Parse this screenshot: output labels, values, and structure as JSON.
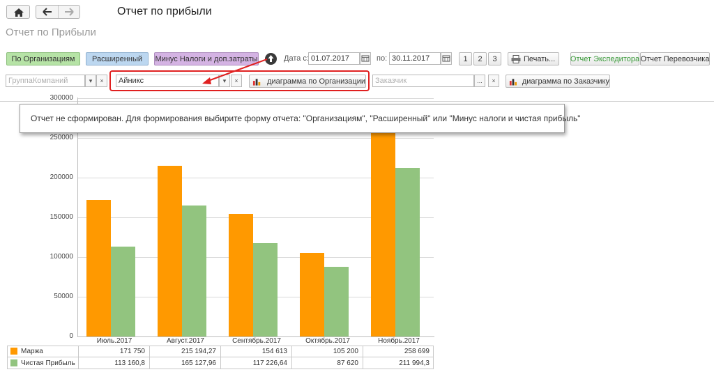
{
  "window": {
    "title": "Отчет по прибыли",
    "form_title": "Отчет по Прибыли"
  },
  "toolbar": {
    "by_org_label": "По Организациям",
    "extended_label": "Расширенный",
    "minus_taxes_label": "Минус Налоги и доп.затраты",
    "date_from_label": "Дата с:",
    "date_from": "01.07.2017",
    "date_to_label": "по:",
    "date_to": "30.11.2017",
    "pages": [
      "1",
      "2",
      "3"
    ],
    "print_label": "Печать...",
    "report_forwarder_label": "Отчет Экспедитора",
    "report_carrier_label": "Отчет Перевозчика"
  },
  "filters": {
    "group_placeholder": "ГруппаКомпаний",
    "org_value": "Айникс",
    "org_chart_label": "диаграмма по Организации",
    "customer_placeholder": "Заказчик",
    "customer_chart_label": "диаграмма по Заказчику"
  },
  "message": "Отчет не сформирован. Для формирования выбирите форму отчета: \"Организациям\", \"Расширенный\" или \"Минус налоги и чистая прибыль\"",
  "colors": {
    "margin": "#ff9900",
    "net_profit": "#92c47f",
    "highlight": "#e02020",
    "by_org_bg": "#b6e3a6",
    "extended_bg": "#bcd7f0",
    "minus_taxes_bg": "#d4b3e3"
  },
  "chart_data": {
    "type": "bar",
    "categories": [
      "Июль.2017",
      "Август.2017",
      "Сентябрь.2017",
      "Октябрь.2017",
      "Ноябрь.2017"
    ],
    "series": [
      {
        "name": "Маржа",
        "values": [
          171750,
          215194.27,
          154613,
          105200,
          258699
        ]
      },
      {
        "name": "Чистая Прибыль",
        "values": [
          113160.8,
          165127.96,
          117226.64,
          87620,
          211994.3
        ]
      }
    ],
    "table": [
      [
        "171 750",
        "215 194,27",
        "154 613",
        "105 200",
        "258 699"
      ],
      [
        "113 160,8",
        "165 127,96",
        "117 226,64",
        "87 620",
        "211 994,3"
      ]
    ],
    "yticks": [
      "0",
      "50000",
      "100000",
      "150000",
      "200000",
      "250000",
      "300000"
    ],
    "ylim": [
      0,
      300000
    ],
    "grid": true,
    "legend_placement": "bottom-table"
  }
}
